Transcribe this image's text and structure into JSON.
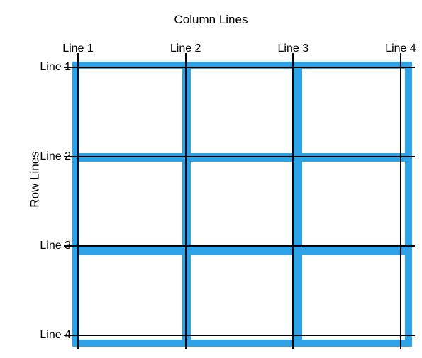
{
  "titles": {
    "columns": "Column Lines",
    "rows": "Row Lines"
  },
  "col_labels": [
    "Line 1",
    "Line 2",
    "Line 3",
    "Line 4"
  ],
  "row_labels": [
    "Line 1",
    "Line 2",
    "Line 3",
    "Line 4"
  ],
  "layout": {
    "innerLeft": 110,
    "innerRight": 565,
    "innerTop": 95,
    "innerBottom": 473,
    "gridPad": 8,
    "colLabelTop": 60,
    "rowLabelRight": 100,
    "lineExtend": 12,
    "lineThickness": 2
  },
  "colors": {
    "grid_fill": "#2ea2e6",
    "line": "#000"
  },
  "chart_data": {
    "type": "table",
    "title": "CSS Grid line numbering diagram",
    "columns": 4,
    "rows": 4,
    "column_lines": [
      1,
      2,
      3,
      4
    ],
    "row_lines": [
      1,
      2,
      3,
      4
    ],
    "cells_columns": 3,
    "cells_rows": 3
  }
}
